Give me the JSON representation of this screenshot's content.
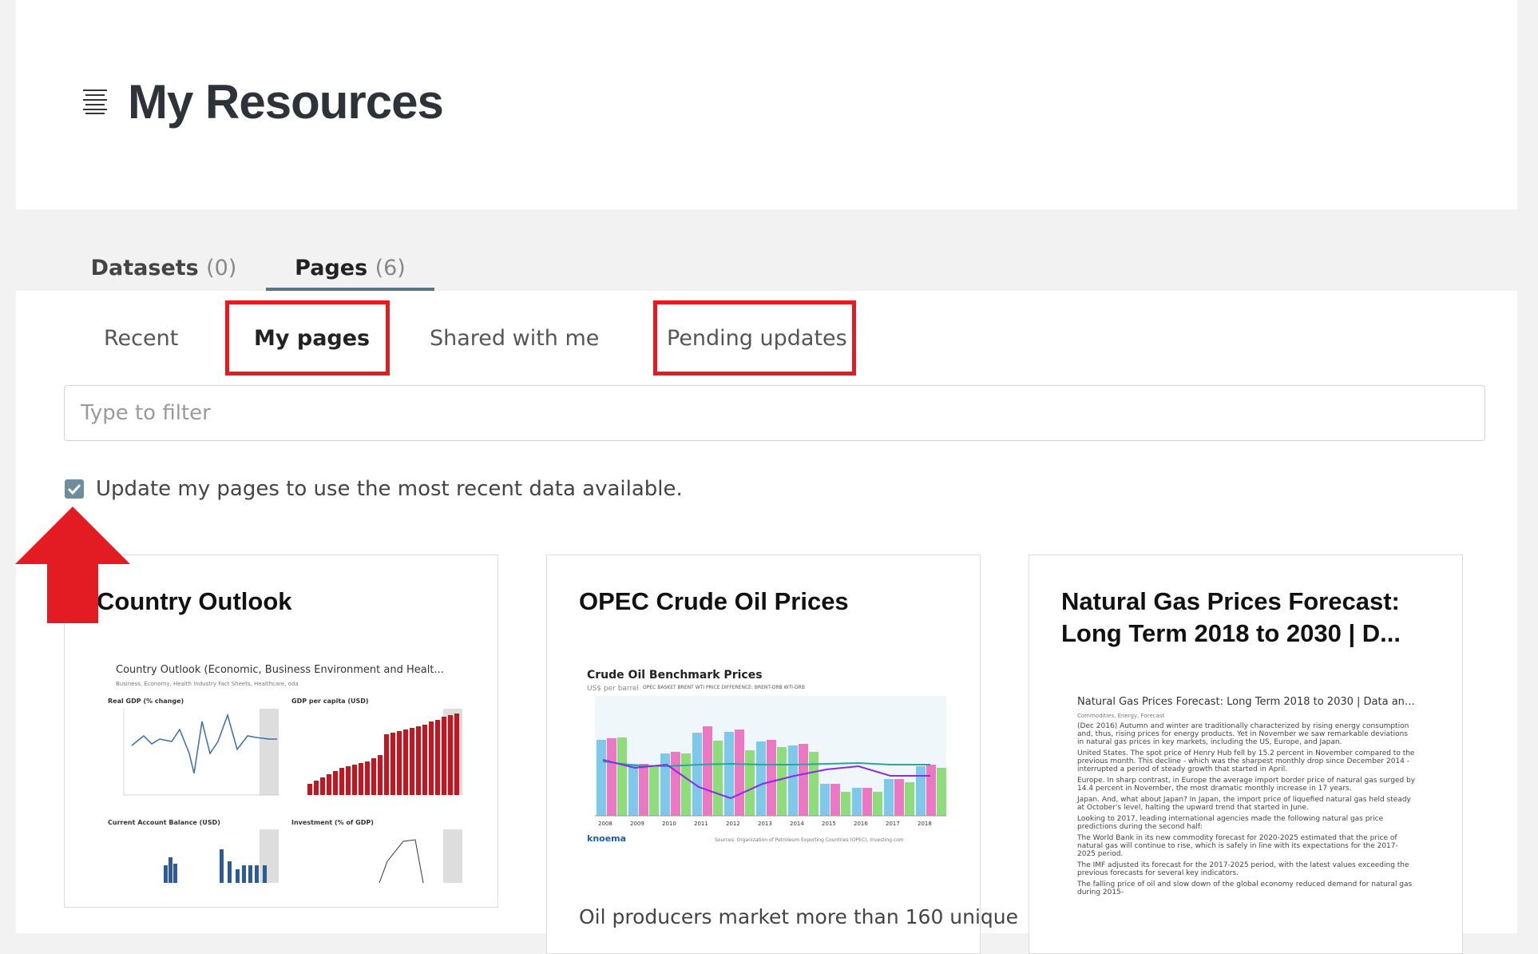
{
  "header": {
    "title": "My Resources",
    "menu_icon": "list-lines-icon"
  },
  "resource_tabs": [
    {
      "label": "Datasets",
      "count": "(0)"
    },
    {
      "label": "Pages",
      "count": "(6)",
      "active": true
    }
  ],
  "sub_tabs": [
    {
      "label": "Recent"
    },
    {
      "label": "My pages",
      "active": true,
      "highlighted": true
    },
    {
      "label": "Shared with me"
    },
    {
      "label": "Pending updates",
      "highlighted": true
    }
  ],
  "filter": {
    "placeholder": "Type to filter",
    "value": ""
  },
  "auto_update": {
    "checked": true,
    "label": "Update my pages to use the most recent data available."
  },
  "annotation": {
    "arrow_color": "#e31b23",
    "highlight_color": "#e31b23"
  },
  "cards": [
    {
      "title": "Country Outlook",
      "thumbnail": {
        "heading": "Country Outlook (Economic, Business Environment and Healt...",
        "tags": "Business, Economy, Health Industry Fact Sheets, Healthcare, oda",
        "panels": [
          "Real GDP (% change)",
          "GDP per capita (USD)",
          "Current Account Balance (USD)",
          "Investment (% of GDP)"
        ]
      },
      "description": ""
    },
    {
      "title": "OPEC Crude Oil Prices",
      "thumbnail": {
        "chart_title": "Crude Oil Benchmark Prices",
        "unit": "US$ per barrel",
        "legend": "OPEC BASKET  BRENT  WTI    PRICE DIFFERENCE: BRENT-DRB  WTI-DRB",
        "years": [
          "2008",
          "2009",
          "2010",
          "2011",
          "2012",
          "2013",
          "2014",
          "2015",
          "2016",
          "2017",
          "2018"
        ],
        "brand": "knoema",
        "source": "Sources: Organization of Petroleum Exporting Countries (OPEC), Investing.com"
      },
      "description": "Oil producers market more than 160 unique"
    },
    {
      "title": "Natural Gas Prices Forecast: Long Term 2018 to 2030 | D...",
      "thumbnail": {
        "heading": "Natural Gas Prices Forecast: Long Term 2018 to 2030 | Data and ...",
        "tags": "Commodities, Energy, Forecast",
        "paragraphs": [
          "(Dec 2016) Autumn and winter are traditionally characterized by rising energy consumption and, thus, rising prices for energy products. Yet in November we saw remarkable deviations in natural gas prices in key markets, including the US, Europe, and Japan.",
          "United States. The spot price of Henry Hub fell by 15.2 percent in November compared to the previous month. This decline - which was the sharpest monthly drop since December 2014 - interrupted a period of steady growth that started in April.",
          "Europe. In sharp contrast, in Europe the average import border price of natural gas surged by 14.4 percent in November, the most dramatic monthly increase in 17 years.",
          "Japan. And, what about Japan? In Japan, the import price of liquefied natural gas held steady at October's level, halting the upward trend that started in June.",
          "Looking to 2017, leading international agencies made the following natural gas price predictions during the second half:",
          "The World Bank in its new commodity forecast for 2020-2025 estimated that the price of natural gas will continue to rise, which is safely in line with its expectations for the 2017-2025 period.",
          "The IMF adjusted its forecast for the 2017-2025 period, with the latest values exceeding the previous forecasts for several key indicators.",
          "The falling price of oil and slow down of the global economy reduced demand for natural gas during 2015-"
        ]
      },
      "description": ""
    }
  ]
}
